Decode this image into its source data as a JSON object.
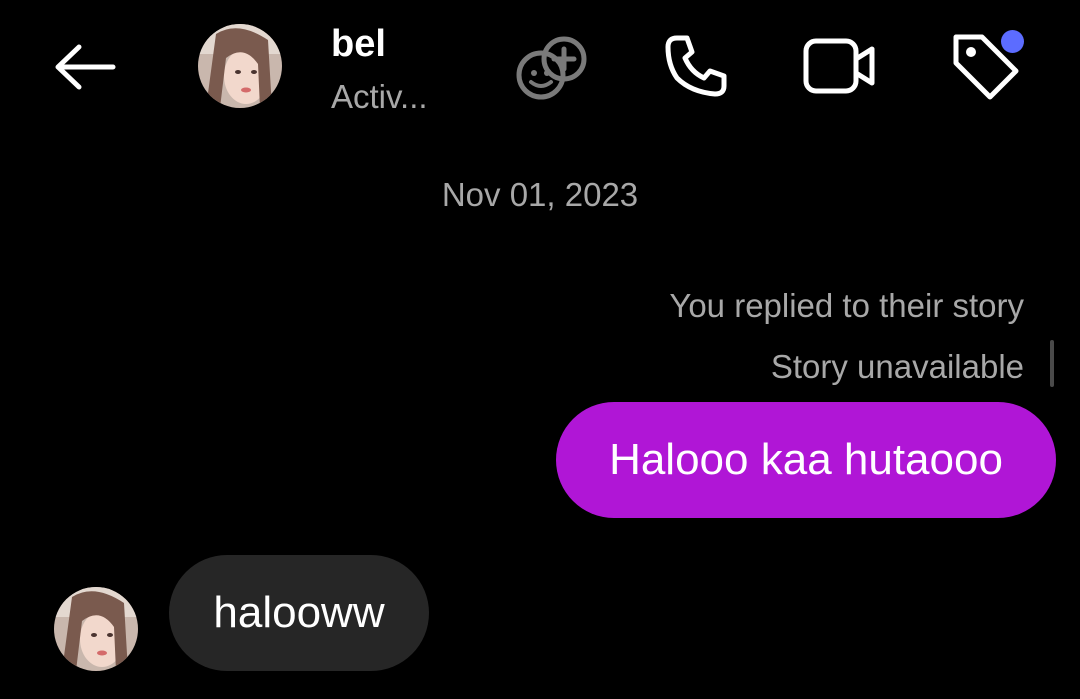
{
  "header": {
    "back_icon": "arrow-left-icon",
    "avatar_icon": "profile-photo",
    "name": "bel",
    "status": "Activ...",
    "effects_icon": "add-effect-face-icon",
    "call_icon": "phone-icon",
    "video_icon": "video-camera-icon",
    "tag_icon": "tag-icon",
    "notification_dot_color": "#5c6cff"
  },
  "conversation": {
    "date": "Nov 01, 2023",
    "reply_meta": "You replied to their story",
    "story_status": "Story unavailable",
    "messages": [
      {
        "direction": "outgoing",
        "text": "Halooo kaa hutaooo",
        "color": "#b016d6"
      },
      {
        "direction": "incoming",
        "text": "halooww",
        "color": "#262626"
      }
    ]
  }
}
